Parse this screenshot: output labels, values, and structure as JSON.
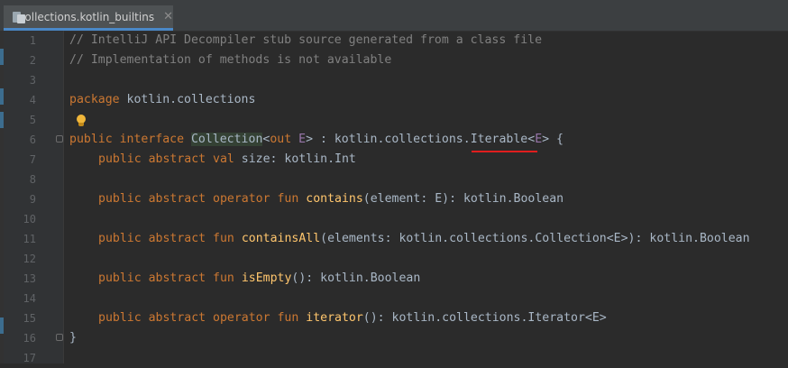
{
  "tab": {
    "title": "collections.kotlin_builtins",
    "close": "✕",
    "icon": "kotlin-file-icon"
  },
  "gutter": {
    "line_numbers": [
      "1",
      "2",
      "3",
      "4",
      "5",
      "6",
      "7",
      "8",
      "9",
      "10",
      "11",
      "12",
      "13",
      "14",
      "15",
      "16",
      "17"
    ]
  },
  "code": {
    "l1": "// IntelliJ API Decompiler stub source generated from a class file",
    "l2": "// Implementation of methods is not available",
    "l4_kw": "package",
    "l4_rest": " kotlin.collections",
    "l6_public": "public",
    "l6_interface": " interface ",
    "l6_name": "Collection",
    "l6_lt": "<",
    "l6_out": "out",
    "l6_space": " ",
    "l6_E": "E",
    "l6_gt_colon": "> : kotlin.collections.",
    "l6_iterable": "Iterable",
    "l6_lt2": "<",
    "l6_E2": "E",
    "l6_end": "> {",
    "l7_kw": "public abstract val",
    "l7_rest": " size: kotlin.Int",
    "l9_kw": "public abstract operator fun",
    "l9_sp": " ",
    "l9_fn": "contains",
    "l9_rest": "(element: E): kotlin.Boolean",
    "l11_kw": "public abstract fun",
    "l11_sp": " ",
    "l11_fn": "containsAll",
    "l11_rest": "(elements: kotlin.collections.Collection<E>): kotlin.Boolean",
    "l13_kw": "public abstract fun",
    "l13_sp": " ",
    "l13_fn": "isEmpty",
    "l13_rest": "(): kotlin.Boolean",
    "l15_kw": "public abstract operator fun",
    "l15_sp": " ",
    "l15_fn": "iterator",
    "l15_rest": "(): kotlin.collections.Iterator<E>",
    "l16": "}"
  },
  "colors": {
    "background": "#2b2b2b",
    "keyword": "#cc7832",
    "function": "#ffc66d",
    "comment": "#808080",
    "type_param": "#9876aa",
    "error_underline": "#e01e1e"
  }
}
